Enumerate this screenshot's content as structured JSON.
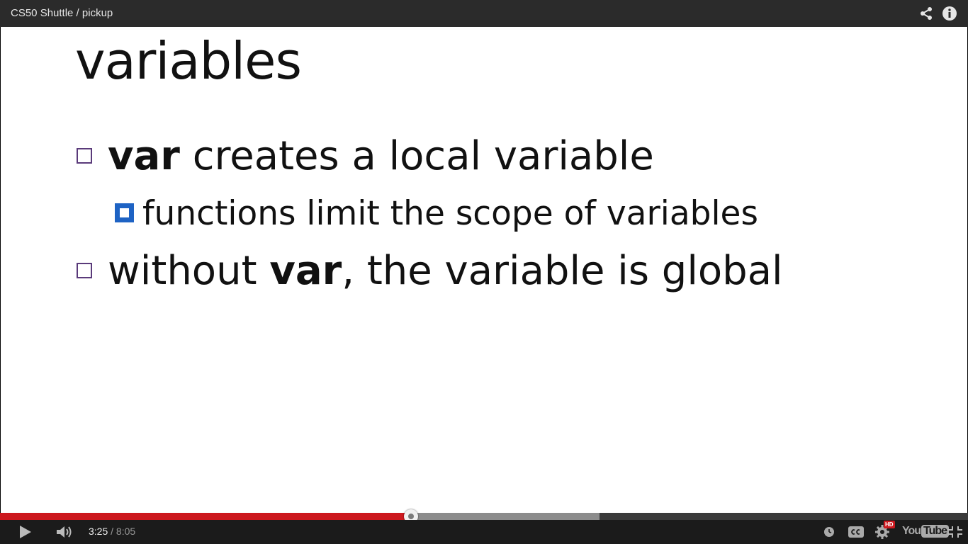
{
  "window": {
    "title": "CS50 Shuttle / pickup"
  },
  "slide": {
    "title": "variables",
    "bullets": [
      {
        "keyword": "var",
        "text": " creates a local variable"
      },
      {
        "text": "functions limit the scope of variables"
      },
      {
        "prefix": "without ",
        "keyword": "var",
        "text": ", the variable is global"
      }
    ]
  },
  "player": {
    "current_time": "3:25",
    "separator": " / ",
    "duration": "8:05",
    "progress_fraction": 0.4247,
    "buffered_fraction": 0.619,
    "hd_label": "HD",
    "logo_you": "You",
    "logo_tube": "Tube"
  },
  "colors": {
    "played": "#cc181e",
    "buffered": "#8c8c8c",
    "track": "#3a3a3a",
    "sub_bullet": "#1e63c4",
    "bullet_outline": "#5a3a7a"
  },
  "icons": {
    "share": "share-icon",
    "info": "info-icon",
    "play": "play-icon",
    "volume": "volume-icon",
    "watch_later": "clock-icon",
    "captions": "cc-icon",
    "settings": "gear-icon",
    "exit_fullscreen": "exit-fullscreen-icon"
  }
}
